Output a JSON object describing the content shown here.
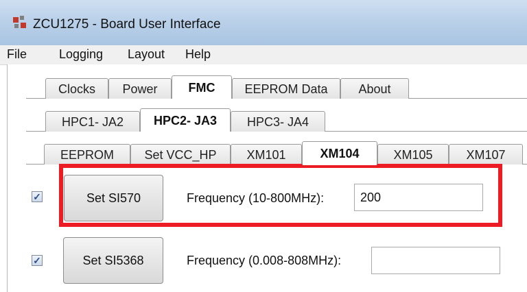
{
  "window": {
    "title": "ZCU1275 - Board User Interface"
  },
  "menu": [
    "File",
    "Logging",
    "Layout",
    "Help"
  ],
  "main_tabs": [
    "Clocks",
    "Power",
    "FMC",
    "EEPROM Data",
    "About"
  ],
  "fmc_tabs": [
    "HPC1- JA2",
    "HPC2- JA3",
    "HPC3- JA4"
  ],
  "sub_tabs": [
    "EEPROM",
    "Set VCC_HP",
    "XM101",
    "XM104",
    "XM105",
    "XM107"
  ],
  "rows": [
    {
      "checked": true,
      "checkmark": "✓",
      "button": "Set SI570",
      "label": "Frequency (10-800MHz):",
      "value": "200"
    },
    {
      "checked": true,
      "checkmark": "✓",
      "button": "Set SI5368",
      "label": "Frequency (0.008-808MHz):",
      "value": ""
    }
  ],
  "colors": {
    "highlight": "#ec1c24",
    "titlebar": "#bcd2ea"
  }
}
